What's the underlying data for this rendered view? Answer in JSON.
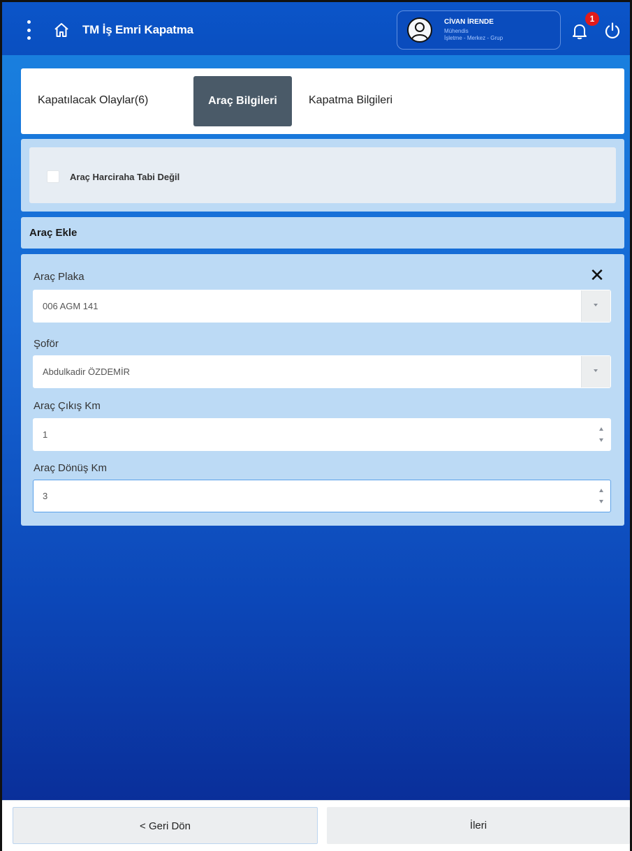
{
  "header": {
    "title": "TM İş Emri Kapatma",
    "user": {
      "name": "CİVAN İRENDE",
      "role": "Mühendis",
      "unit": "İşletme - Merkez - Grup"
    },
    "notification_count": "1",
    "icons": [
      "more-vertical-icon",
      "home-icon",
      "user-avatar-icon",
      "bell-icon",
      "power-icon"
    ]
  },
  "tabs": [
    {
      "label": "Kapatılacak Olaylar(6)",
      "active": false
    },
    {
      "label": "Araç Bilgileri",
      "active": true
    },
    {
      "label": "Kapatma Bilgileri",
      "active": false
    }
  ],
  "options": {
    "per_diem_exempt_label": "Araç Harciraha Tabi Değil",
    "per_diem_exempt_checked": false
  },
  "vehicle_section": {
    "title": "Araç Ekle",
    "close_symbol": "✕",
    "fields": {
      "plate": {
        "label": "Araç Plaka",
        "value": "006 AGM 141"
      },
      "driver": {
        "label": "Şoför",
        "value": "Abdulkadir ÖZDEMİR"
      },
      "exit_km": {
        "label": "Araç Çıkış Km",
        "value": "1"
      },
      "return_km": {
        "label": "Araç Dönüş Km",
        "value": "3"
      }
    }
  },
  "footer": {
    "back_label": "< Geri Dön",
    "next_label": "İleri"
  },
  "colors": {
    "header": "#0b55c9",
    "active_tab": "#4a5a68",
    "panel": "#bcdaf5",
    "badge": "#e21b1b"
  }
}
